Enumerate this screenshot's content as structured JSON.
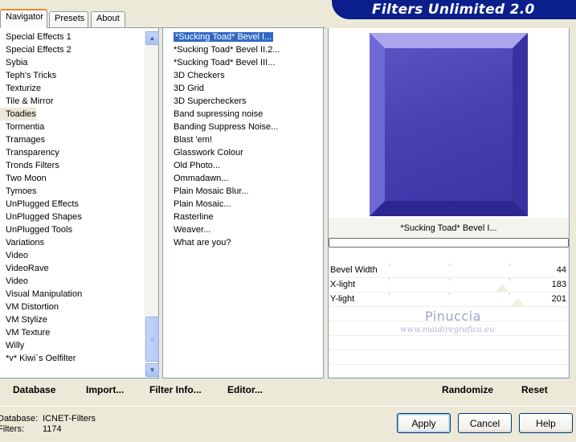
{
  "tabs": [
    {
      "label": "Navigator",
      "active": true
    },
    {
      "label": "Presets",
      "active": false
    },
    {
      "label": "About",
      "active": false
    }
  ],
  "banner": {
    "title": "Filters Unlimited 2.0"
  },
  "categories": [
    "Special Effects 1",
    "Special Effects 2",
    "Sybia",
    "Teph's Tricks",
    "Texturize",
    "Tile & Mirror",
    "Toadies",
    "Tormentia",
    "Tramages",
    "Transparency",
    "Tronds Filters",
    "Two Moon",
    "Tymoes",
    "UnPlugged Effects",
    "UnPlugged Shapes",
    "UnPlugged Tools",
    "Variations",
    "Video",
    "VideoRave",
    "Video",
    "Visual Manipulation",
    "VM Distortion",
    "VM Stylize",
    "VM Texture",
    "Willy",
    "*v* Kiwi`s Oelfilter"
  ],
  "selected_category": "Toadies",
  "filters": [
    "*Sucking Toad*  Bevel I...",
    "*Sucking Toad*  Bevel II.2...",
    "*Sucking Toad*  Bevel III...",
    "3D Checkers",
    "3D Grid",
    "3D Supercheckers",
    "Band supressing noise",
    "Banding Suppress Noise...",
    "Blast 'em!",
    "Glasswork Colour",
    "Old Photo...",
    "Ommadawn...",
    "Plain Mosaic Blur...",
    "Plain Mosaic...",
    "Rasterline",
    "Weaver...",
    "What are you?"
  ],
  "selected_filter": "*Sucking Toad*  Bevel I...",
  "preview": {
    "filter_name": "*Sucking Toad*  Bevel I...",
    "progress": 0
  },
  "params": [
    {
      "label": "Bevel Width",
      "value": "44",
      "fraction": 0.17
    },
    {
      "label": "X-light",
      "value": "183",
      "fraction": 0.72
    },
    {
      "label": "Y-light",
      "value": "201",
      "fraction": 0.79
    }
  ],
  "watermark": {
    "line1": "Pinuccia",
    "line2": "www.maidiregrafica.eu"
  },
  "toolbar": {
    "database": "Database",
    "import": "Import...",
    "filter_info": "Filter Info...",
    "editor": "Editor...",
    "randomize": "Randomize",
    "reset": "Reset"
  },
  "status": {
    "database_label": "Database:",
    "database_value": "ICNET-Filters",
    "filters_label": "Filters:",
    "filters_value": "1174"
  },
  "dialog_buttons": {
    "apply": "Apply",
    "cancel": "Cancel",
    "help": "Help"
  },
  "colors": {
    "selection": "#316ac5",
    "banner": "#0b1f8c",
    "preview": "#4a3fb0"
  }
}
